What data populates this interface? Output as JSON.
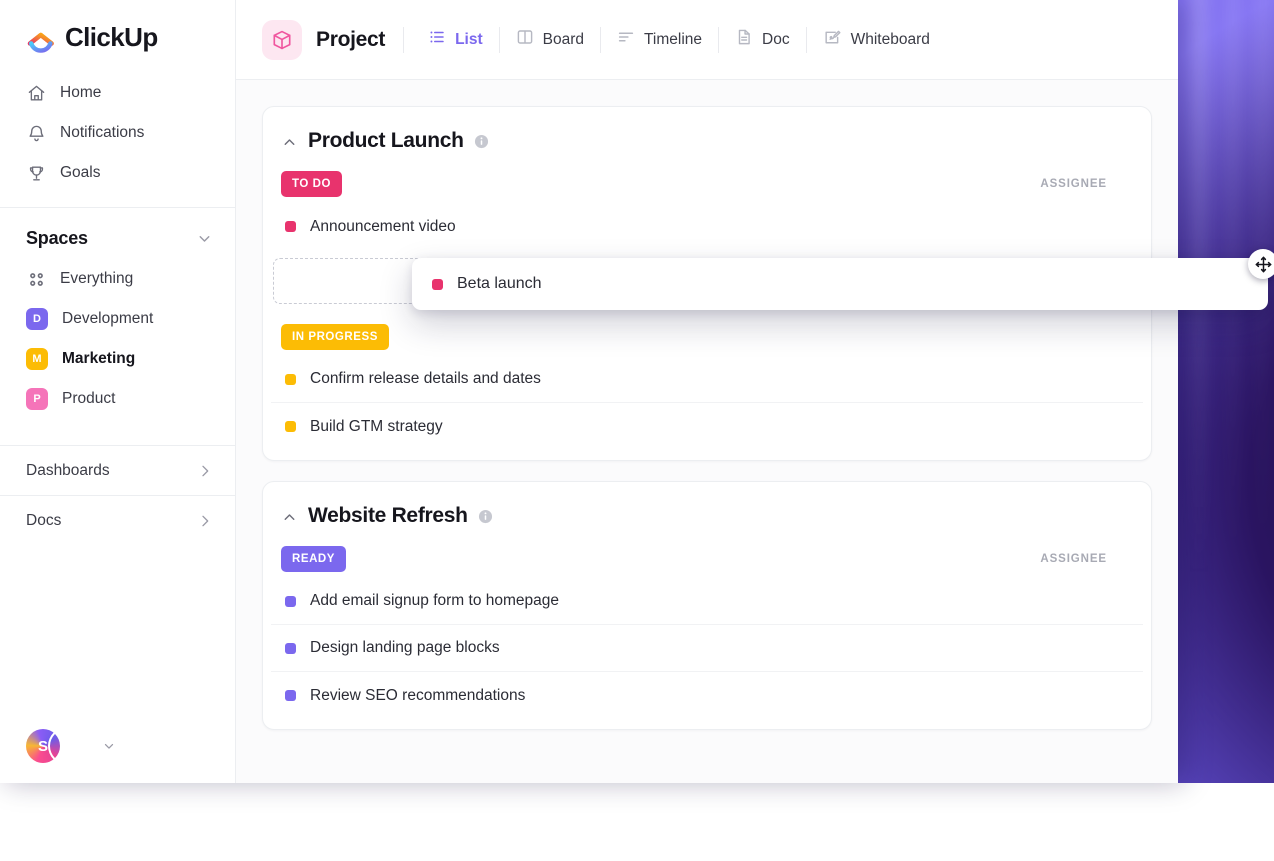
{
  "brand": {
    "name": "ClickUp"
  },
  "sidebar": {
    "nav": [
      {
        "label": "Home",
        "icon": "home-icon"
      },
      {
        "label": "Notifications",
        "icon": "bell-icon"
      },
      {
        "label": "Goals",
        "icon": "trophy-icon"
      }
    ],
    "spaces_title": "Spaces",
    "spaces": [
      {
        "label": "Everything",
        "icon": "grid-dots-icon",
        "initial": "",
        "color": "",
        "active": false
      },
      {
        "label": "Development",
        "icon": "space-avatar",
        "initial": "D",
        "color": "#7b68ee",
        "active": false
      },
      {
        "label": "Marketing",
        "icon": "space-avatar",
        "initial": "M",
        "color": "#fcbc05",
        "active": true
      },
      {
        "label": "Product",
        "icon": "space-avatar",
        "initial": "P",
        "color": "#f574b9",
        "active": false
      }
    ],
    "footer_links": [
      {
        "label": "Dashboards",
        "icon": "chevron-right-icon"
      },
      {
        "label": "Docs",
        "icon": "chevron-right-icon"
      }
    ],
    "user": {
      "workspace_initial": "S",
      "avatar": "user-avatar",
      "chevron": "chevron-down-icon"
    }
  },
  "topbar": {
    "project_icon": "cube-icon",
    "project_name": "Project",
    "tabs": [
      {
        "label": "List",
        "icon": "list-icon",
        "active": true
      },
      {
        "label": "Board",
        "icon": "board-icon",
        "active": false
      },
      {
        "label": "Timeline",
        "icon": "timeline-icon",
        "active": false
      },
      {
        "label": "Doc",
        "icon": "doc-icon",
        "active": false
      },
      {
        "label": "Whiteboard",
        "icon": "whiteboard-icon",
        "active": false
      }
    ]
  },
  "assignee_column_label": "ASSIGNEE",
  "groups": [
    {
      "title": "Product Launch",
      "info_icon": "info-icon",
      "caret": "chevron-up-icon",
      "statuses": [
        {
          "label": "TO DO",
          "color": "#e8336d",
          "dot_color": "#e8336d",
          "show_assignee_header": true,
          "tasks": [
            {
              "name": "Announcement video",
              "avatar": "avatar-1"
            }
          ],
          "has_drop_placeholder": true
        },
        {
          "label": "IN PROGRESS",
          "color": "#fcbc05",
          "dot_color": "#fcbc05",
          "show_assignee_header": false,
          "tasks": [
            {
              "name": "Confirm release details and dates",
              "avatar": "avatar-2"
            },
            {
              "name": "Build GTM strategy",
              "avatar": "avatar-3"
            }
          ],
          "has_drop_placeholder": false
        }
      ]
    },
    {
      "title": "Website Refresh",
      "info_icon": "info-icon",
      "caret": "chevron-up-icon",
      "statuses": [
        {
          "label": "READY",
          "color": "#7b68ee",
          "dot_color": "#7b68ee",
          "show_assignee_header": true,
          "tasks": [
            {
              "name": "Add email signup form to homepage",
              "avatar": "avatar-4"
            },
            {
              "name": "Design landing page blocks",
              "avatar": "avatar-5"
            },
            {
              "name": "Review SEO recommendations",
              "avatar": "avatar-6"
            }
          ],
          "has_drop_placeholder": false
        }
      ]
    }
  ],
  "drag_card": {
    "task_name": "Beta launch",
    "dot_color": "#e8336d",
    "avatar": "avatar-7",
    "cursor_icon": "move-cursor-icon"
  }
}
